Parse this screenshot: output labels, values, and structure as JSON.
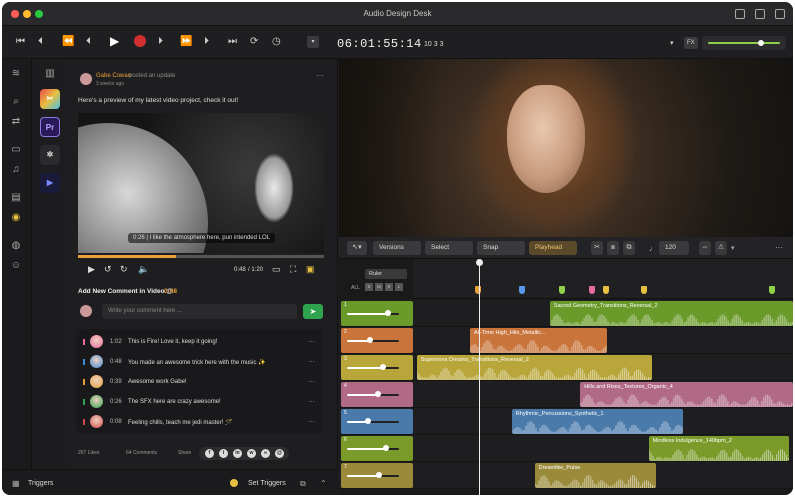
{
  "app": {
    "title": "Audio Design Desk"
  },
  "transport": {
    "timecode": "06:01:55:14",
    "bars": "10 3 3",
    "fx_label": "FX"
  },
  "post": {
    "author": "Gabe Cowan",
    "action": "posted an update",
    "time": "3 weeks ago",
    "body": "Here's a preview of my latest video project, check it out!",
    "video_caption": "0:26 | I like the atmosphere here, pun intended LOL",
    "video_time": "0:48",
    "video_duration": "/ 1:20",
    "progress": 0.4
  },
  "comment_section": {
    "heading": "Add New Comment in Video @",
    "heading_time": "0:48",
    "placeholder": "Write your comment here ...",
    "comments": [
      {
        "time": "1:02",
        "text": "This is Fire! Love it, keep it going!",
        "color": "#e86aa0"
      },
      {
        "time": "0:48",
        "text": "You made an awesome trick here with the music ✨",
        "color": "#3a8ad8"
      },
      {
        "time": "0:39",
        "text": "Awesome work Gabe!",
        "color": "#e8a03a"
      },
      {
        "time": "0:26",
        "text": "The SFX here are crazy awesome!",
        "color": "#2ea44f"
      },
      {
        "time": "0:08",
        "text": "Feeling chills, teach me jedi master! 🪄",
        "color": "#d04a4a"
      }
    ]
  },
  "social": {
    "likes": "267 Likes",
    "comments": "64 Comments",
    "share": "Share"
  },
  "bottom": {
    "triggers": "Triggers",
    "set_triggers": "Set Triggers"
  },
  "editbar": {
    "versions": "Versions",
    "select": "Select",
    "snap": "Snap",
    "playhead": "Playhead",
    "tempo": "120"
  },
  "timeline": {
    "ruler_label": "Ruler",
    "all_label": "ALL",
    "tracks": [
      {
        "num": "1",
        "color": "#6a9a2a",
        "knob": 0.78,
        "clip": {
          "name": "Sacred Geometry_Transitions_Reversal_2",
          "color": "#6a9a2a",
          "start": 0.36,
          "width": 0.64
        }
      },
      {
        "num": "2",
        "color": "#c8743a",
        "knob": 0.45,
        "clip": {
          "name": "All-Time High_Hits_Metallic...",
          "color": "#c8743a",
          "start": 0.15,
          "width": 0.36
        }
      },
      {
        "num": "3",
        "color": "#b8a63a",
        "knob": 0.7,
        "clip": {
          "name": "Supernova Dreams_Transitions_Reversal_2",
          "color": "#b8a63a",
          "start": 0.01,
          "width": 0.62
        }
      },
      {
        "num": "4",
        "color": "#b06a86",
        "knob": 0.6,
        "clip": {
          "name": "Hills and Rises_Textures_Organic_4",
          "color": "#b06a86",
          "start": 0.44,
          "width": 0.56
        }
      },
      {
        "num": "5",
        "color": "#4a7aaa",
        "knob": 0.4,
        "clip": {
          "name": "Rhythmic_Percussions_Synthetic_1",
          "color": "#4a7aaa",
          "start": 0.26,
          "width": 0.45
        }
      },
      {
        "num": "6",
        "color": "#7a9a2a",
        "knob": 0.75,
        "clip": {
          "name": "Mindless Indulgence_140bpm_2",
          "color": "#7a9a2a",
          "start": 0.62,
          "width": 0.37
        }
      },
      {
        "num": "7",
        "color": "#9a8a3a",
        "knob": 0.62,
        "clip": {
          "name": "Dreamlike_Pulse",
          "color": "#9a8a3a",
          "start": 0.32,
          "width": 0.32
        }
      }
    ]
  }
}
